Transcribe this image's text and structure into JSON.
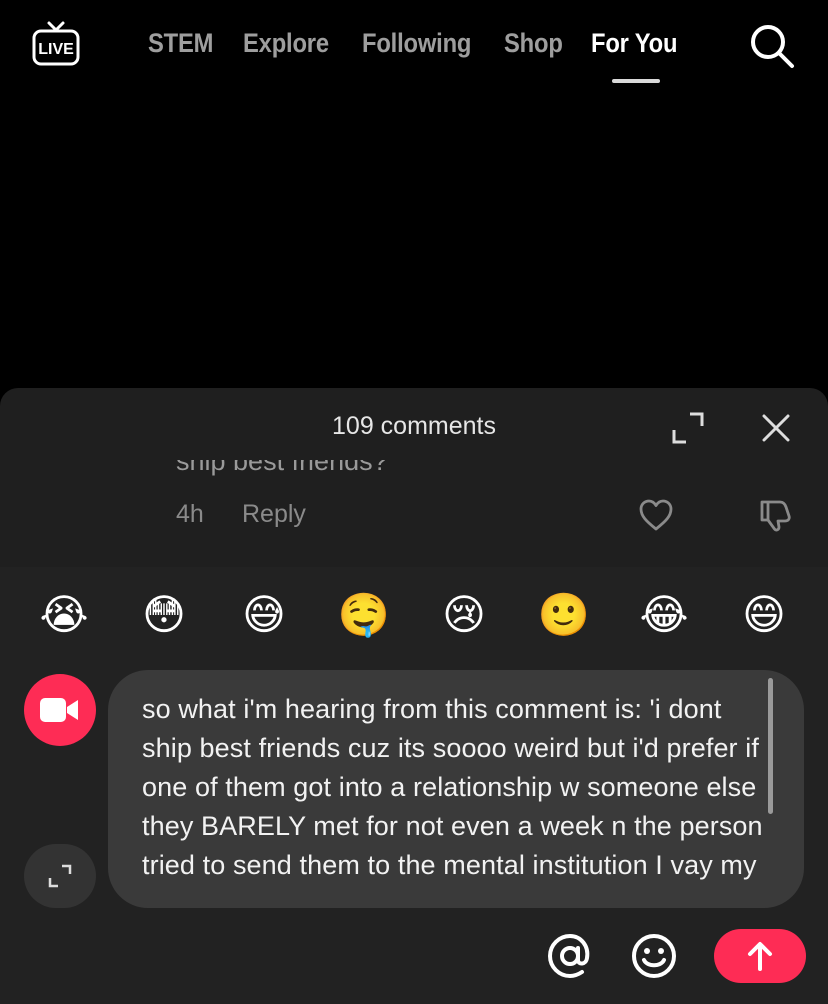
{
  "nav": {
    "live_label": "LIVE",
    "tabs": [
      {
        "label": "STEM"
      },
      {
        "label": "Explore"
      },
      {
        "label": "Following"
      },
      {
        "label": "Shop"
      },
      {
        "label": "For You",
        "active": true
      }
    ],
    "icons": {
      "search": "search-icon"
    }
  },
  "comments": {
    "count_label": "109 comments",
    "icons": {
      "expand": "expand-icon",
      "close": "close-icon"
    },
    "items": [
      {
        "text": "ship best friends?",
        "time": "4h",
        "reply_label": "Reply",
        "icons": {
          "like": "heart-icon",
          "dislike": "thumbs-down-icon"
        }
      }
    ]
  },
  "composer": {
    "quick_emojis": [
      "😭",
      "😳",
      "😅",
      "🤤",
      "😢",
      "🙂",
      "😂",
      "😄"
    ],
    "input_value": "so what i'm hearing from this comment is: 'i dont ship best friends cuz its soooo weird but i'd prefer if one of them got into a relationship w someone else they BARELY met for not even a week n the person tried to send them to the mental institution I vay my",
    "icons": {
      "video": "video-camera-icon",
      "fullscreen": "expand-arrows-icon",
      "mention": "at-sign-icon",
      "emoji": "smiley-icon",
      "send": "arrow-up-icon"
    }
  },
  "colors": {
    "accent": "#fe2c55",
    "sheet_bg": "#1f1f1f",
    "composer_bg": "#222222",
    "input_bg": "#3a3a3a"
  }
}
